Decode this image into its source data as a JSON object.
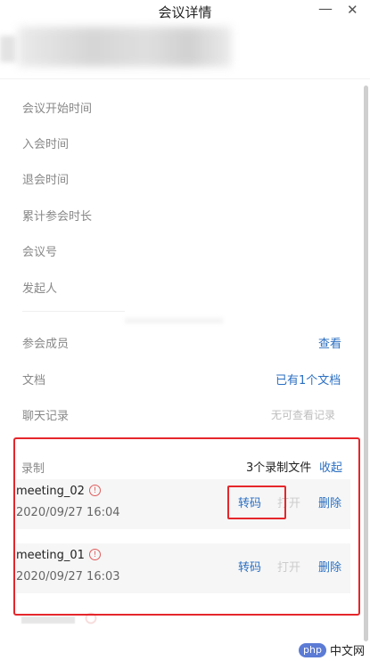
{
  "window": {
    "title": "会议详情",
    "minimize_glyph": "—",
    "close_glyph": "✕"
  },
  "info_labels": [
    "会议开始时间",
    "入会时间",
    "退会时间",
    "累计参会时长",
    "会议号",
    "发起人"
  ],
  "rows": {
    "members": {
      "label": "参会成员",
      "action": "查看"
    },
    "docs": {
      "label": "文档",
      "action": "已有1个文档"
    },
    "chat": {
      "label": "聊天记录",
      "status": "无可查看记录"
    }
  },
  "recording": {
    "label": "录制",
    "count": "3个录制文件",
    "collapse": "收起",
    "files": [
      {
        "name": "meeting_02",
        "time": "2020/09/27 16:04",
        "transcode": "转码",
        "open": "打开",
        "delete": "删除"
      },
      {
        "name": "meeting_01",
        "time": "2020/09/27 16:03",
        "transcode": "转码",
        "open": "打开",
        "delete": "删除"
      }
    ]
  },
  "watermark": {
    "badge": "php",
    "text": "中文网"
  },
  "colors": {
    "link": "#2b6fc2",
    "highlight": "#e5262b",
    "warning": "#e05b5b"
  }
}
